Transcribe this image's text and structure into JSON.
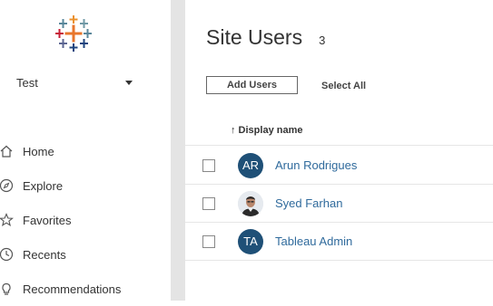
{
  "sidebar": {
    "site_name": "Test",
    "nav": [
      {
        "label": "Home",
        "icon": "home-icon"
      },
      {
        "label": "Explore",
        "icon": "compass-icon"
      },
      {
        "label": "Favorites",
        "icon": "star-icon"
      },
      {
        "label": "Recents",
        "icon": "clock-icon"
      },
      {
        "label": "Recommendations",
        "icon": "lightbulb-icon"
      }
    ]
  },
  "main": {
    "title": "Site Users",
    "count": "3",
    "add_users_label": "Add Users",
    "select_all_label": "Select All",
    "column_header": "↑ Display name",
    "users": [
      {
        "initials": "AR",
        "name": "Arun Rodrigues"
      },
      {
        "initials": "",
        "name": "Syed Farhan"
      },
      {
        "initials": "TA",
        "name": "Tableau Admin"
      }
    ]
  },
  "colors": {
    "avatar": "#1f5077",
    "link": "#2f6a9c"
  }
}
